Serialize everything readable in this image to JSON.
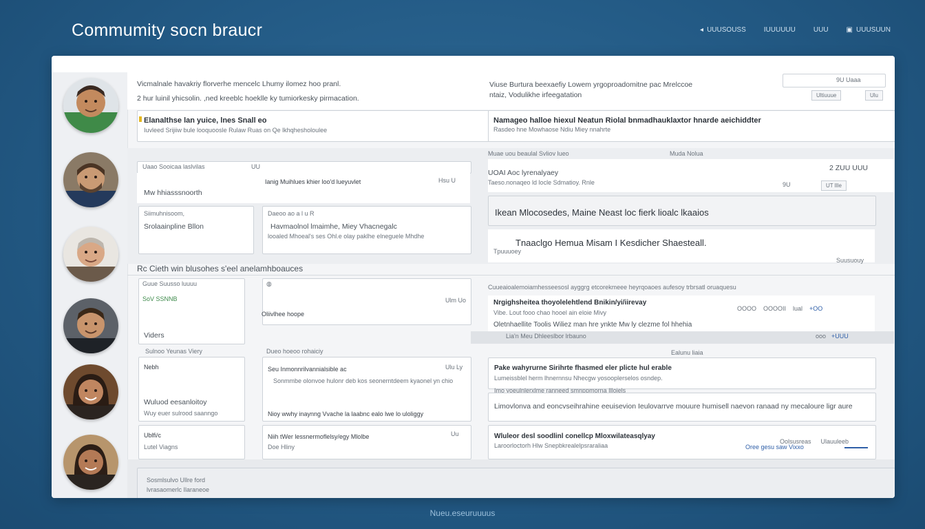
{
  "app": {
    "title": "Commumity socn braucr"
  },
  "nav": [
    {
      "label": "UUUSOUSS",
      "icon": "back-arrow-icon"
    },
    {
      "label": "IUUUUUU",
      "icon": ""
    },
    {
      "label": "UUU",
      "icon": ""
    },
    {
      "label": "UUUSUUN",
      "icon": "square-icon"
    }
  ],
  "footer": "Nueu.eseuruuuus",
  "members": [
    {
      "name": "member-1"
    },
    {
      "name": "member-2"
    },
    {
      "name": "member-3"
    },
    {
      "name": "member-4"
    },
    {
      "name": "member-5"
    },
    {
      "name": "member-6"
    }
  ],
  "header": {
    "line1": "Vicmalnale havakriy florverhe mencelc Lhumy ilomez hoo pranl.",
    "line2": "2 hur luinil yhicsolin. ,ned kreeblc hoeklle ky tumiorkesky pirmacation.",
    "right_line1": "Viuse Burtura beexaefiy Lowem yrgoproadomitne pac Mrelccoe",
    "right_line2": "ntaiz, Vodulikhe irfeegatation",
    "right_pills": [
      "9U Uaaa",
      "Ultiuuue",
      "Ulu"
    ]
  },
  "intro": {
    "title": "Elanalthse lan yuice, lnes Snall eo",
    "sub": "Iuvleed Srijiiw bule looquoosle Rulaw Ruas on Qe lkhqhesholoulee",
    "right_title": "Namageo halloe hiexul Neatun Riolal bnmadhauklaxtor hnarde aeichiddter",
    "right_sub": "Rasdeo hne Mowhaose Ndiu Miey nnahrte"
  },
  "forum": {
    "search_placeholder": "Uaao Sooicaa laslvilas",
    "search_count": "UU",
    "label_a": "Mw hhiasssnoorth",
    "label_b": "Ianig Muihlues khier loo'd lueyuvlet",
    "tag_a": "Hsu U",
    "box1_head": "Siimuhnisoom,",
    "box1_body": "Srolaainpline Bllon",
    "box2_head": "Daeoo ao a l  u  R",
    "box2_title": "Havmaolnol lmaimhe, Miey Vhacnegalc",
    "box2_body": "looaled Mhoeal's ses Ohl.e olay paklhe elneguele Mhdhe"
  },
  "right_top": {
    "header_a": "Muae uou beaulal Svliov lueo",
    "header_b": "Muda Nolua",
    "row1_label": "UOAI Aoc lyrenalyaey",
    "row1_value": "2 ZUU UUU",
    "row2_label": "Taeso.nonaqeo ld locle Sdmatioy. Rnle",
    "row2_value": "UT lIle",
    "row2_extra": "9U",
    "callout1": "Ikean Mlocosedes, Maine Neast loc fierk lioalc lkaaios",
    "callout2": "Tnaaclgo Hemua Misam I Kesdicher Shaesteall.",
    "callout2_sub": "Tpuuuoey",
    "callout2_badge": "Suusuouy"
  },
  "section2": {
    "title": "Rc Cieth win blusohes s'eel anelamhboauces"
  },
  "members_panel": {
    "search": "Guue Suusso luuuu",
    "tag": "SoV SSNNB",
    "label_v": "Viders",
    "head_2": "Sulnoo Yeunas Viery",
    "card_a": "Nebh",
    "card_b": "Wuluod eesanloitoy",
    "card_b_sub": "Wuy euer sulrood saanngo",
    "card_c": "Ublfi/c",
    "card_c_sub": "Lutel Viagns"
  },
  "threads": {
    "search": "",
    "item1": "Oliivlhee hoope",
    "item1_meta": "Ulm  Uo",
    "head": "Dueo  hoeoo rohaiciy",
    "item2_title": "Seu Inmonnrilvannialsible ac",
    "item2_meta": "Ulu  Ly",
    "item2_body": "Sonmmbe olonvoe hulonr deb kos seonerntdeem kyaonel yn chio",
    "item2_foot": "Nioy wwhy inaynng Vvache la laabnc ealo lwe lo uloliggy",
    "item3_title": "Niih tWer lessnermoflelsy/egy Mlolbe",
    "item3_meta": "Uu",
    "item3_sub": "Doe Hliny"
  },
  "feed": {
    "intro": "Cuueaioalemoiamhesseesosl ayggrg etcorekmeee heyrqoaoes aufesoy trbrsatl oruaquesu",
    "post1_title": "Nrgighsheitea thoyolelehtlend Bnikin/yi/iirevay",
    "post1_meta": "Vibe. Lout fooo chao hooel ain eloie Mivy",
    "post1_stats": [
      "OOOO",
      "OOOOII",
      "lual",
      "+OO"
    ],
    "post1_body": "Oletnhaellite Toolis Wiliez man hre ynkte Mw ly clezme fol hhehia",
    "post1_foot": "Lia'n Meu Dhleeslbor lrbauno",
    "post1_stat2": [
      "ooo",
      "+UUU"
    ],
    "label": "Ealunu liaia",
    "post2_title": "Pake wahyrurne Sirihrte fhasmed eler plicte hul erable",
    "post2_sub": "Lumeissblel herm lhnernnsu Nhecgw yosooplerselos osndep.",
    "post2_body": "Imo yoeulnlerxlme ranneed smnppmorna Illoiels",
    "post3_body": "Limovlonva and eoncvseihrahine eeuisevion Ieulovarrve mouure humisell naevon ranaad ny mecaloure ligr aure",
    "post4_title": "Wluleor desl soodlinl conellcp Mloxwilateasqlyay",
    "post4_sub": "Laroorloctorh  Hlw Snepbkrealelpsraraliaa",
    "post4_stats": [
      "Oolsusreas",
      "Ulauuleeb"
    ],
    "post4_foot": "Oree gesu saw Vixxo"
  },
  "composer": {
    "line1": "Sosmlsulvo Ullre ford",
    "line2": "lvrasaomerlc Ilaraneoe"
  }
}
